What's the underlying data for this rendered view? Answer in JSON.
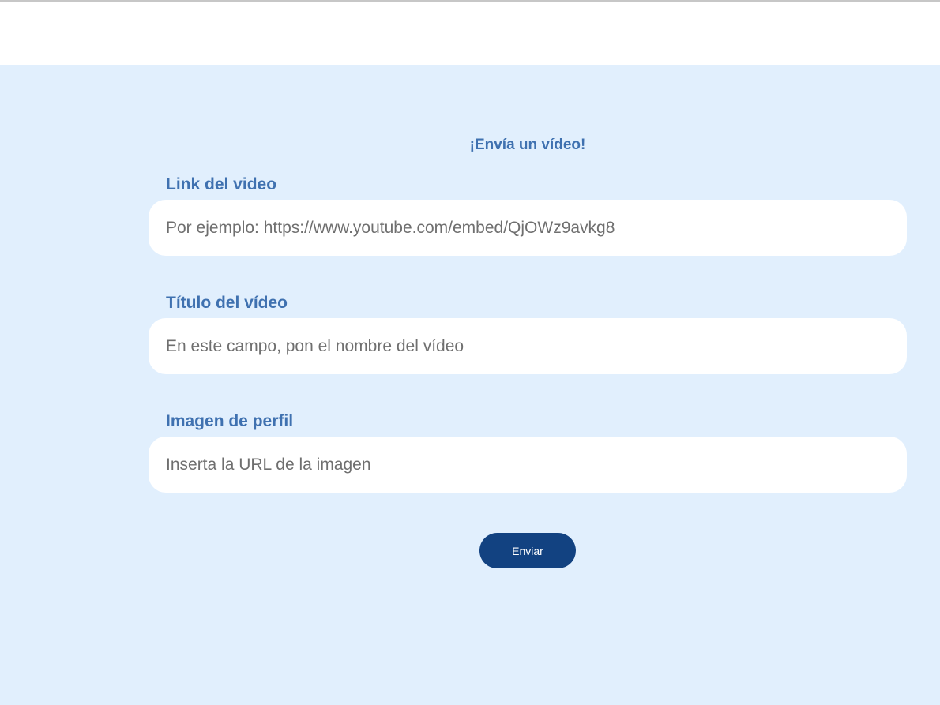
{
  "form": {
    "title": "¡Envía un vídeo!",
    "fields": [
      {
        "label": "Link del video",
        "value": "",
        "placeholder": "Por ejemplo: https://www.youtube.com/embed/QjOWz9avkg8"
      },
      {
        "label": "Título del vídeo",
        "value": "",
        "placeholder": "En este campo, pon el nombre del vídeo"
      },
      {
        "label": "Imagen de perfil",
        "value": "",
        "placeholder": "Inserta la URL de la imagen"
      }
    ],
    "submit_label": "Enviar"
  },
  "colors": {
    "background": "#e1effd",
    "label": "#3f71b0",
    "button": "#124281",
    "button_text": "#ffffff",
    "input_background": "#ffffff",
    "placeholder": "#6f6f6f"
  }
}
